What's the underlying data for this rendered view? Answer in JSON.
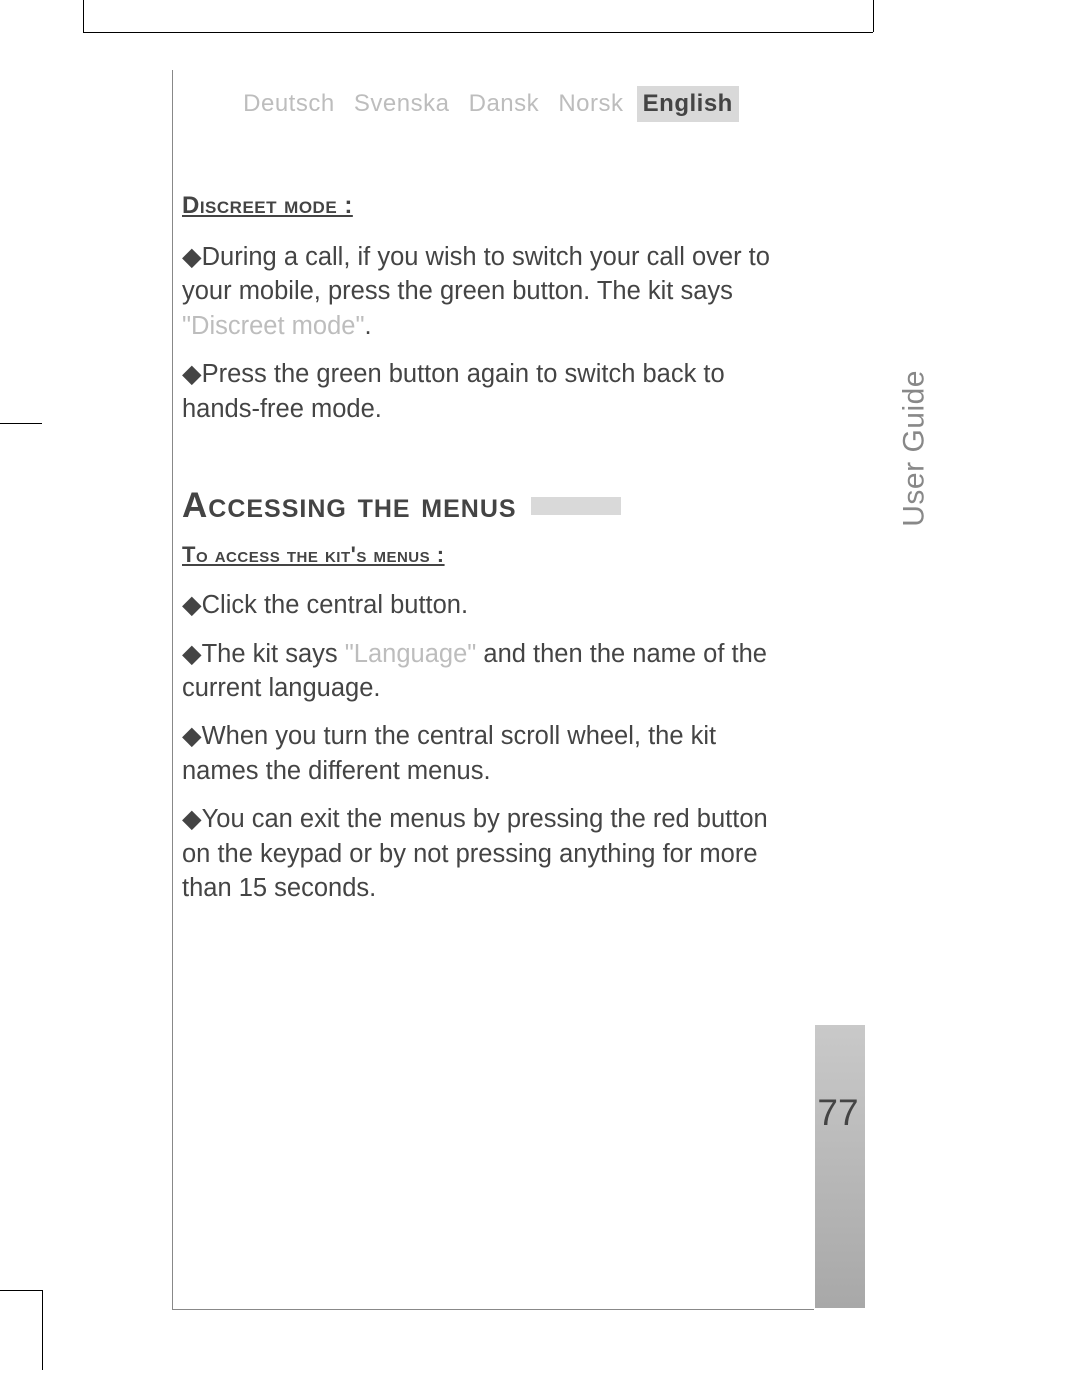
{
  "languages": {
    "items": [
      "Deutsch",
      "Svenska",
      "Dansk",
      "Norsk",
      "English"
    ],
    "active_index": 4
  },
  "side_label": "User Guide",
  "page_number": "77",
  "section1": {
    "heading": "Discreet mode :",
    "p1_pre": "◆During a call, if you wish to switch your call over to your mobile, press the green button. The kit says ",
    "p1_say": "\"Discreet mode\"",
    "p1_post": ".",
    "p2": "◆Press the green button again to switch back to hands-free mode."
  },
  "section2": {
    "heading": "Accessing the menus",
    "sub": "To access the kit's menus :",
    "p1": "◆Click the central button.",
    "p2_pre": "◆The kit says  ",
    "p2_say": "\"Language\"",
    "p2_post": " and then the name of the current language.",
    "p3": "◆When you turn the central scroll wheel, the kit names the different menus.",
    "p4": "◆You can exit the menus by pressing the red button on the keypad or by not pressing anything for more than 15 seconds."
  }
}
